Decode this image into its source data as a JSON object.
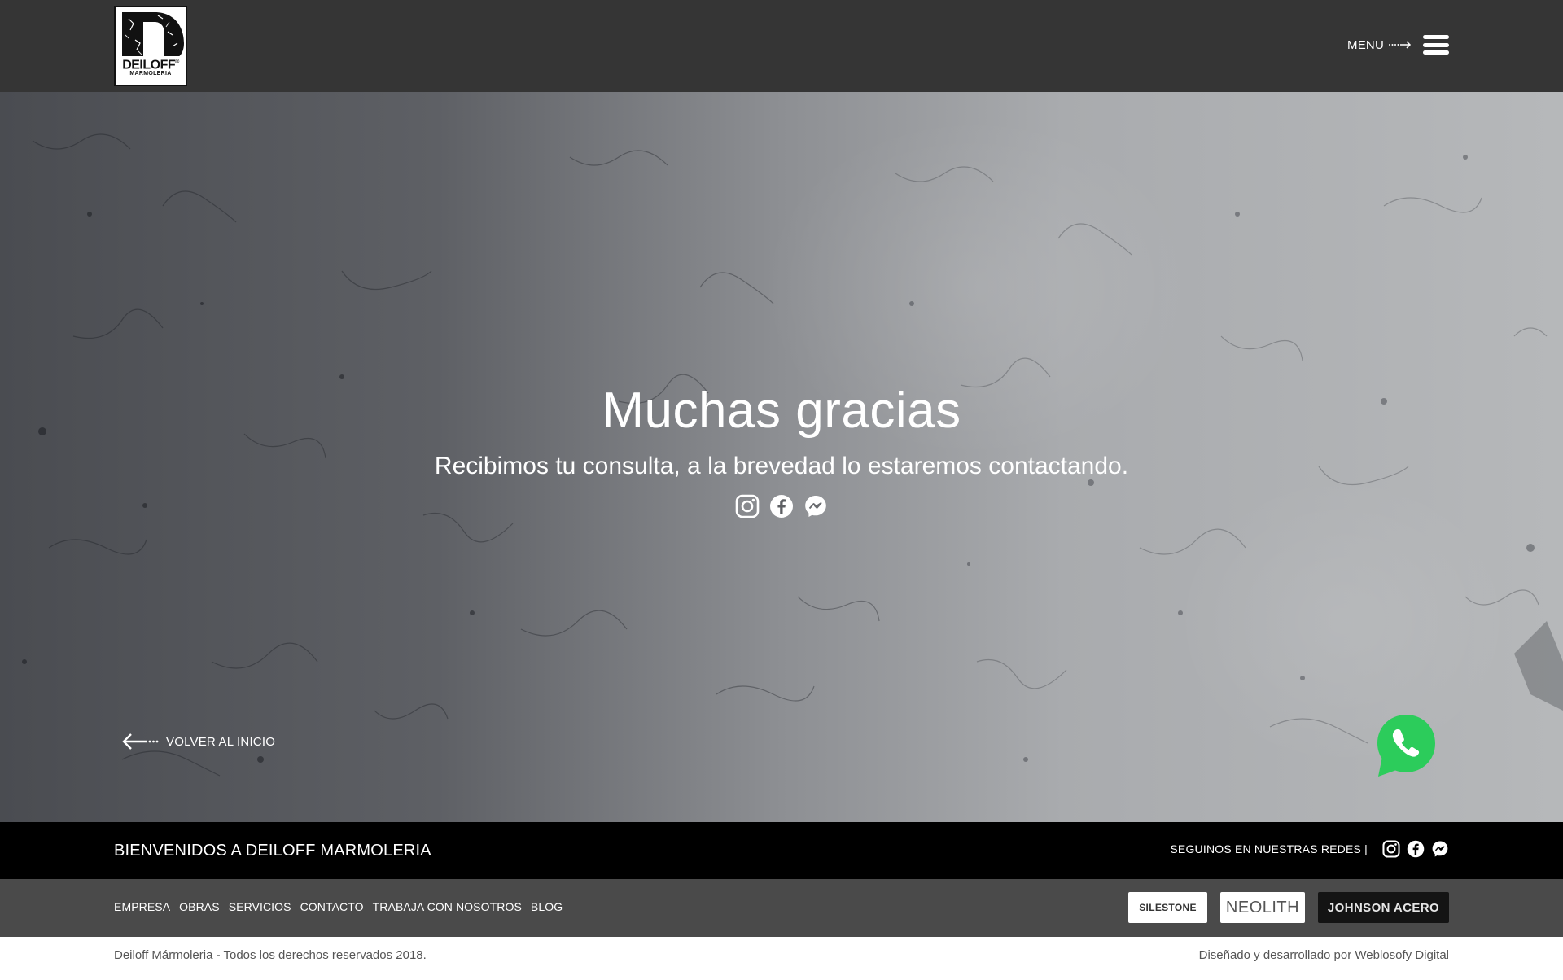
{
  "header": {
    "logo": {
      "name": "DEILOFF",
      "registered": "®",
      "subtitle": "MARMOLERIA"
    },
    "menu_label": "MENU",
    "menu_icon": "hamburger-icon"
  },
  "hero": {
    "title": "Muchas gracias",
    "subtitle": "Recibimos tu consulta, a la brevedad lo estaremos contactando.",
    "social": [
      {
        "icon": "instagram-icon"
      },
      {
        "icon": "facebook-icon"
      },
      {
        "icon": "messenger-icon"
      }
    ],
    "back_label": "VOLVER AL INICIO",
    "whatsapp_icon": "whatsapp-icon",
    "whatsapp_color": "#2ccc5b"
  },
  "footer": {
    "band_title": "BIENVENIDOS A DEILOFF MARMOLERIA",
    "follow_label": "SEGUINOS EN NUESTRAS REDES |",
    "nav": [
      "EMPRESA",
      "OBRAS",
      "SERVICIOS",
      "CONTACTO",
      "TRABAJA CON NOSOTROS",
      "BLOG"
    ],
    "brands": [
      "SILESTONE",
      "NEOLITH",
      "JOHNSON ACERO"
    ],
    "copyright": "Deiloff Mármoleria - Todos los derechos reservados 2018.",
    "credits": "Diseñado y desarrollado por Weblosofy Digital"
  },
  "colors": {
    "header_bg": "#353535",
    "band_bg": "#000000",
    "links_bg": "#4a4a4a",
    "whatsapp": "#2ccc5b"
  }
}
